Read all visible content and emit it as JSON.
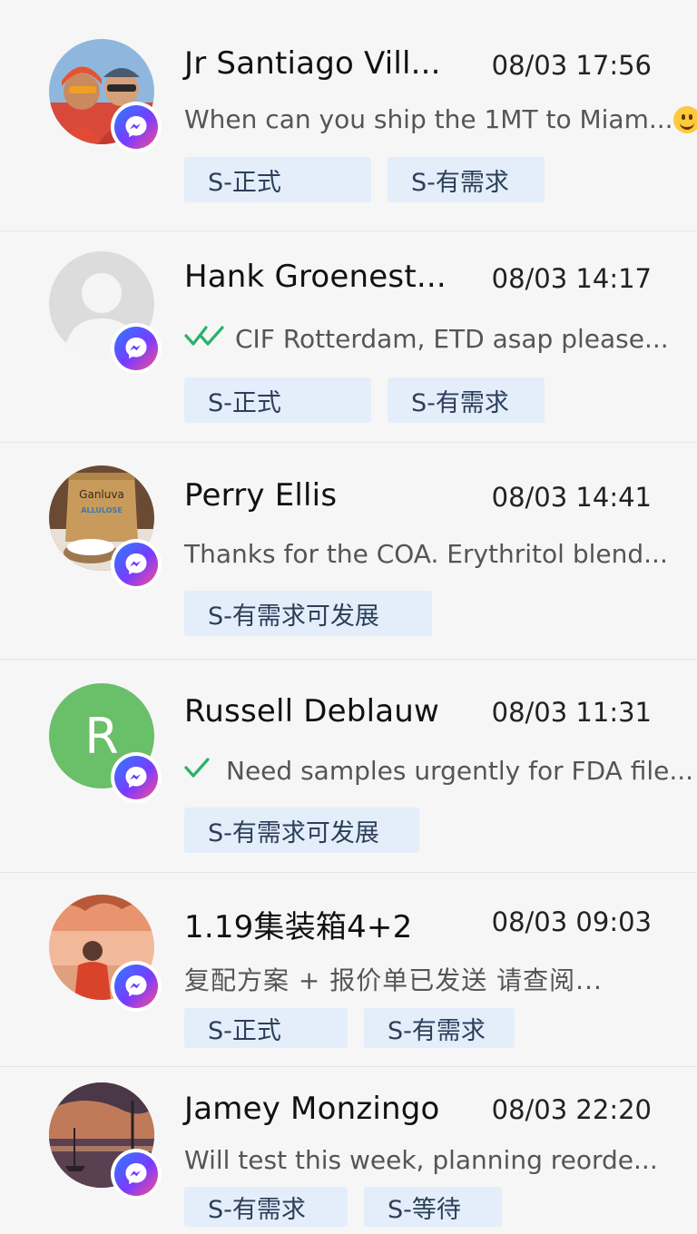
{
  "colors": {
    "background": "#f6f6f6",
    "tag_bg": "#e3eefa",
    "tag_text": "#2c3e5a",
    "tick_green": "#27b36a",
    "messenger_gradient": [
      "#2a7cff",
      "#7a3cff",
      "#ff4d8a"
    ]
  },
  "chats": [
    {
      "name": "Jr Santiago Vill...",
      "time": "08/03 17:56",
      "preview": "When can you ship the 1MT to Miam...",
      "status_icon": "none",
      "trailing_emoji": "slightly-smiling-face-emoji",
      "avatar": "photo-two-people",
      "channel_icon": "messenger-icon",
      "tags": [
        "S-正式",
        "S-有需求"
      ]
    },
    {
      "name": "Hank Groenest...",
      "time": "08/03 14:17",
      "preview": "CIF Rotterdam, ETD asap please...",
      "status_icon": "double-check-icon",
      "avatar": "placeholder-silhouette",
      "channel_icon": "messenger-icon",
      "tags": [
        "S-正式",
        "S-有需求"
      ]
    },
    {
      "name": "Perry Ellis",
      "time": "08/03 14:41",
      "preview": "Thanks for the COA. Erythritol blend...",
      "status_icon": "none",
      "avatar": "photo-product-bag",
      "avatar_text": {
        "brand": "Ganluva",
        "product": "ALLULOSE"
      },
      "channel_icon": "messenger-icon",
      "tags": [
        "S-有需求可发展"
      ]
    },
    {
      "name": "Russell Deblauw",
      "time": "08/03 11:31",
      "preview": "Need samples urgently for FDA file...",
      "status_icon": "single-check-icon",
      "avatar": "initial-letter",
      "avatar_letter": "R",
      "avatar_color": "#6abf69",
      "channel_icon": "messenger-icon",
      "tags": [
        "S-有需求可发展"
      ]
    },
    {
      "name": "1.19集装箱4+2",
      "time": "08/03 09:03",
      "preview": "复配方案 + 报价单已发送 请查阅...",
      "status_icon": "none",
      "avatar": "photo-person-sunset",
      "channel_icon": "messenger-icon",
      "tags": [
        "S-正式",
        "S-有需求"
      ]
    },
    {
      "name": "Jamey Monzingo",
      "time": "08/03 22:20",
      "preview": "Will test this week, planning reorde...",
      "status_icon": "none",
      "avatar": "photo-harbor-sunset",
      "channel_icon": "messenger-icon",
      "tags": [
        "S-有需求",
        "S-等待"
      ]
    }
  ]
}
